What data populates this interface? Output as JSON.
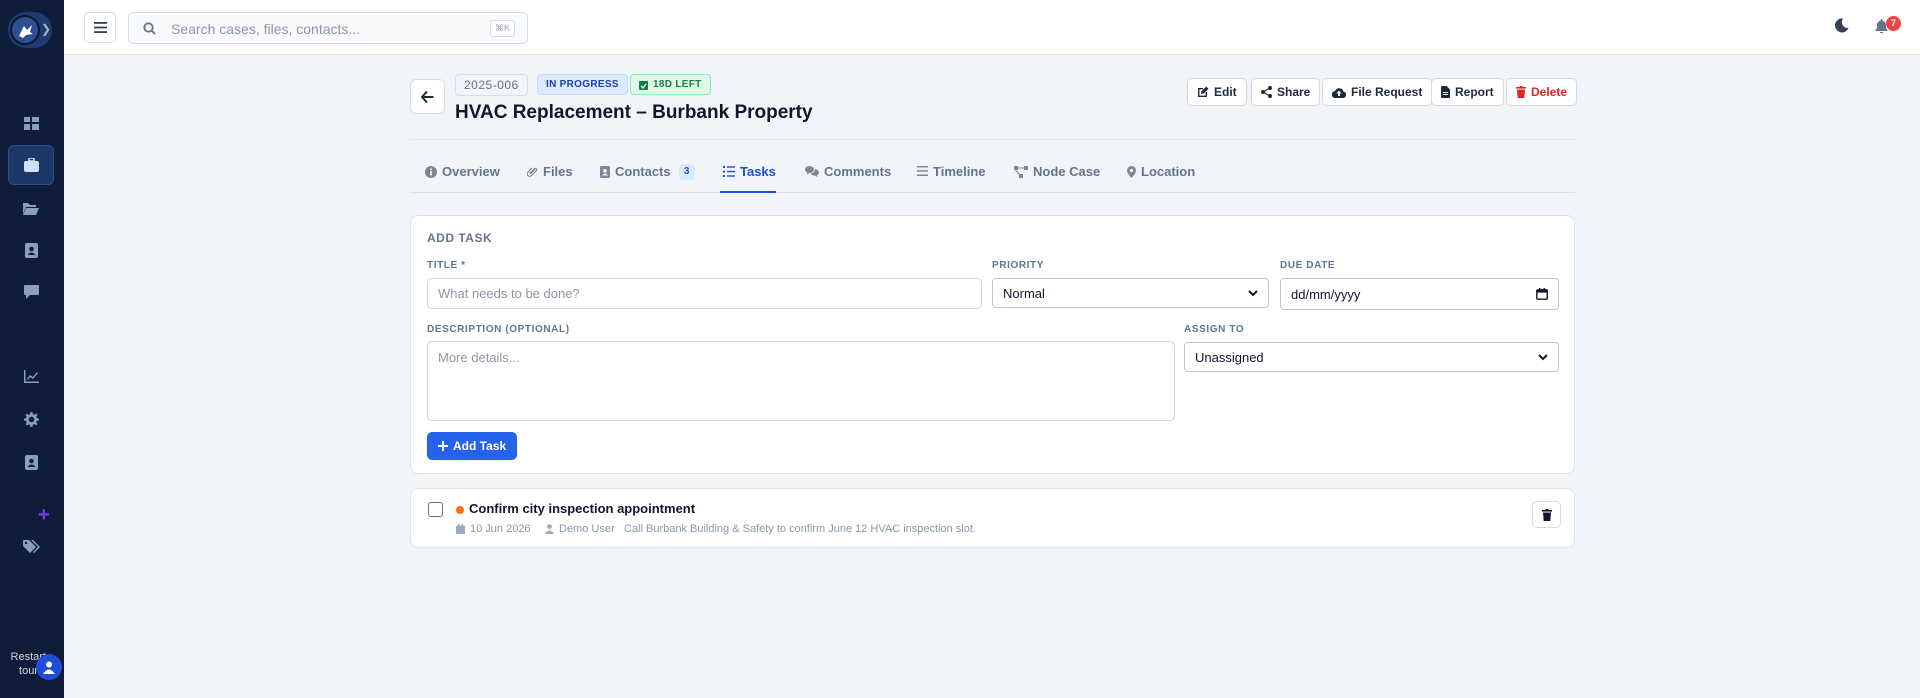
{
  "sidebar": {
    "nav_icons": [
      "dashboard-icon",
      "briefcase-icon",
      "folder-open-icon",
      "contact-book-icon",
      "comment-icon",
      "chart-line-icon",
      "gear-icon",
      "address-card-icon",
      "tags-icon"
    ],
    "active": "briefcase-icon",
    "restart_tour_label_1": "Restart",
    "restart_tour_label_2": "tour"
  },
  "topbar": {
    "search_placeholder": "Search cases, files, contacts...",
    "search_shortcut": "⌘K",
    "notification_count": "7"
  },
  "case": {
    "number": "2025-006",
    "status": "IN PROGRESS",
    "days_left": "18D LEFT",
    "title": "HVAC Replacement – Burbank Property"
  },
  "actions": {
    "edit": "Edit",
    "share": "Share",
    "file_request": "File Request",
    "report": "Report",
    "delete": "Delete"
  },
  "tabs": [
    {
      "label": "Overview",
      "icon": "info-circle-icon"
    },
    {
      "label": "Files",
      "icon": "paperclip-icon"
    },
    {
      "label": "Contacts",
      "icon": "address-book-icon",
      "count": "3"
    },
    {
      "label": "Tasks",
      "icon": "list-check-icon",
      "active": true
    },
    {
      "label": "Comments",
      "icon": "comments-icon"
    },
    {
      "label": "Timeline",
      "icon": "bars-icon"
    },
    {
      "label": "Node Case",
      "icon": "diagram-icon"
    },
    {
      "label": "Location",
      "icon": "map-pin-icon"
    }
  ],
  "add_task": {
    "heading": "ADD TASK",
    "title_label": "TITLE *",
    "title_placeholder": "What needs to be done?",
    "priority_label": "PRIORITY",
    "priority_value": "Normal",
    "due_label": "DUE DATE",
    "due_placeholder": "dd/mm/yyyy",
    "description_label": "DESCRIPTION (OPTIONAL)",
    "description_placeholder": "More details...",
    "assign_label": "ASSIGN TO",
    "assign_value": "Unassigned",
    "submit_label": "Add Task"
  },
  "tasks": [
    {
      "title": "Confirm city inspection appointment",
      "priority_color": "#f97316",
      "date": "10 Jun 2026",
      "assignee": "Demo User",
      "note": "Call Burbank Building & Safety to confirm June 12 HVAC inspection slot."
    }
  ],
  "colors": {
    "sidebar_bg": "#0f1d3a",
    "accent": "#2563eb",
    "danger": "#dc2626"
  }
}
